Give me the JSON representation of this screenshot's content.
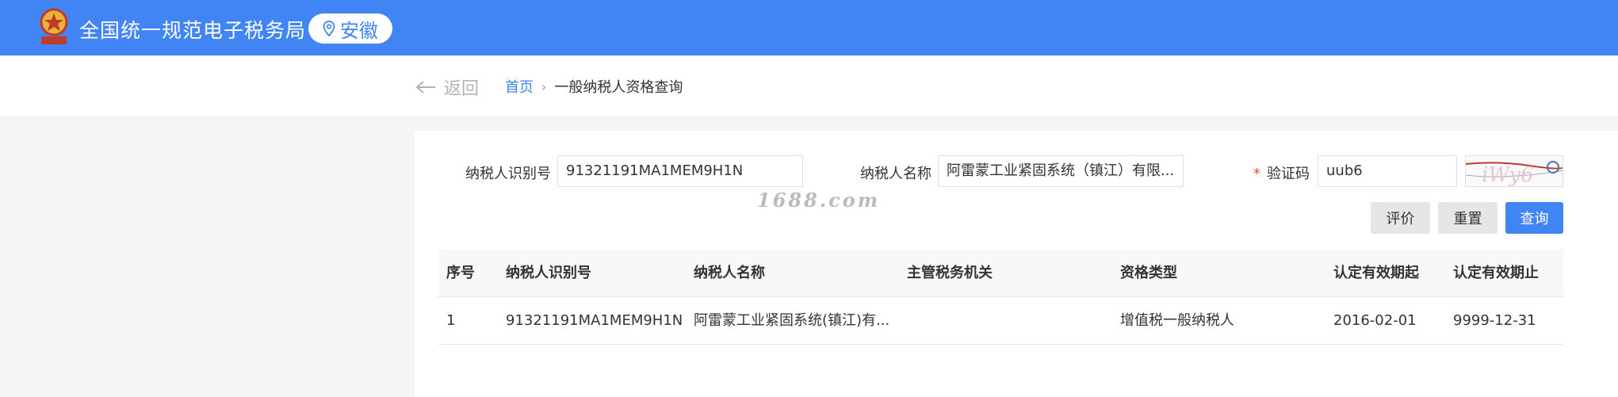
{
  "header": {
    "site_title": "全国统一规范电子税务局",
    "region": "安徽",
    "emblem_text": "中国税务"
  },
  "nav": {
    "back_label": "返回",
    "breadcrumb_home": "首页",
    "breadcrumb_sep": "›",
    "breadcrumb_current": "一般纳税人资格查询"
  },
  "form": {
    "taxpayer_id_label": "纳税人识别号",
    "taxpayer_id_value": "91321191MA1MEM9H1N",
    "taxpayer_name_label": "纳税人名称",
    "taxpayer_name_value": "阿雷蒙工业紧固系统（镇江）有限...",
    "captcha_required_mark": "*",
    "captcha_label": "验证码",
    "captcha_value": "uub6",
    "captcha_image_text": "iWy6"
  },
  "watermark": "1688.com",
  "buttons": {
    "evaluate": "评价",
    "reset": "重置",
    "query": "查询"
  },
  "table": {
    "columns": [
      "序号",
      "纳税人识别号",
      "纳税人名称",
      "主管税务机关",
      "资格类型",
      "认定有效期起",
      "认定有效期止"
    ],
    "rows": [
      [
        "1",
        "91321191MA1MEM9H1N",
        "阿雷蒙工业紧固系统(镇江)有...",
        "",
        "增值税一般纳税人",
        "2016-02-01",
        "9999-12-31"
      ]
    ]
  },
  "colors": {
    "brand_blue": "#4185f4",
    "required_red": "#e74c3c"
  }
}
